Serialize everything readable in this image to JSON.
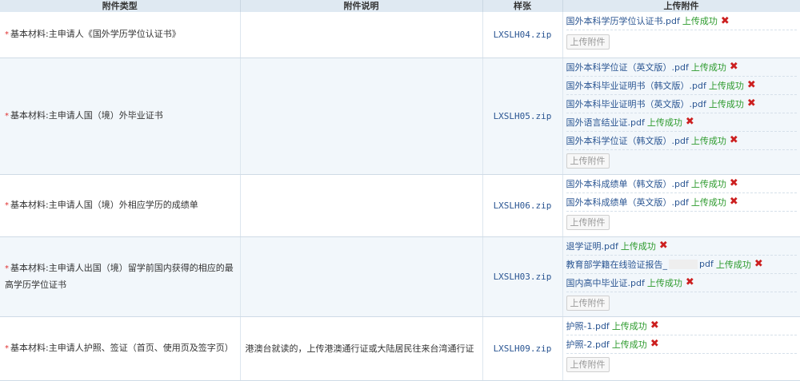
{
  "headers": [
    "附件类型",
    "附件说明",
    "样张",
    "上传附件"
  ],
  "rows": [
    {
      "type": "基本材料:主申请人《国外学历学位认证书》",
      "desc": "",
      "sample": "LXSLH04.zip",
      "files": [
        "国外本科学历学位认证书.pdf"
      ]
    },
    {
      "type": "基本材料:主申请人国（境）外毕业证书",
      "desc": "",
      "sample": "LXSLH05.zip",
      "files": [
        "国外本科学位证（英文版）.pdf",
        "国外本科毕业证明书（韩文版）.pdf",
        "国外本科毕业证明书（英文版）.pdf",
        "国外语言结业证.pdf",
        "国外本科学位证（韩文版）.pdf"
      ]
    },
    {
      "type": "基本材料:主申请人国（境）外相应学历的成绩单",
      "desc": "",
      "sample": "LXSLH06.zip",
      "files": [
        "国外本科成绩单（韩文版）.pdf",
        "国外本科成绩单（英文版）.pdf"
      ]
    },
    {
      "type_line1": "基本材料:主申请人出国（境）留学前国内获得的相应的最",
      "type_line2": "高学历学位证书",
      "desc": "",
      "sample": "LXSLH03.zip",
      "files": [
        "退学证明.pdf",
        "教育部学籍在线验证报告_",
        "国内高中毕业证.pdf"
      ],
      "file2_suffix": "pdf"
    },
    {
      "type": "基本材料:主申请人护照、签证（首页、使用页及签字页）",
      "desc": "港澳台就读的，上传港澳通行证或大陆居民往来台湾通行证",
      "sample": "LXSLH09.zip",
      "files": [
        "护照-1.pdf",
        "护照-2.pdf"
      ]
    }
  ],
  "status_ok": "上传成功",
  "delete_icon": "✖",
  "upload_button": "上传附件",
  "required_mark": "*",
  "colors": {
    "header_bg": "#dfe9f2",
    "link": "#2a5592",
    "ok": "#2c9a2c",
    "delete": "#cc1f1f",
    "required": "#e03030"
  }
}
